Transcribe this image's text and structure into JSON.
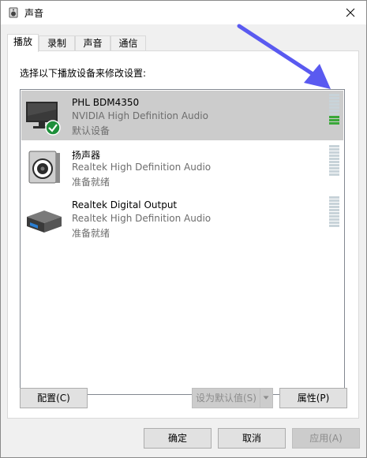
{
  "window": {
    "title": "声音"
  },
  "tabs": [
    {
      "label": "播放",
      "active": true
    },
    {
      "label": "录制",
      "active": false
    },
    {
      "label": "声音",
      "active": false
    },
    {
      "label": "通信",
      "active": false
    }
  ],
  "panel": {
    "instruction": "选择以下播放设备来修改设置:"
  },
  "devices": [
    {
      "name": "PHL BDM4350",
      "driver": "NVIDIA High Definition Audio",
      "status": "默认设备",
      "icon": "monitor-default-icon",
      "selected": true,
      "level": 0.3
    },
    {
      "name": "扬声器",
      "driver": "Realtek High Definition Audio",
      "status": "准备就绪",
      "icon": "speaker-icon",
      "selected": false,
      "level": 0
    },
    {
      "name": "Realtek Digital Output",
      "driver": "Realtek High Definition Audio",
      "status": "准备就绪",
      "icon": "digital-output-icon",
      "selected": false,
      "level": 0
    }
  ],
  "panel_buttons": {
    "configure": "配置(C)",
    "set_default": "设为默认值(S)",
    "properties": "属性(P)"
  },
  "dialog_buttons": {
    "ok": "确定",
    "cancel": "取消",
    "apply": "应用(A)"
  },
  "colors": {
    "selection": "#cccccc",
    "meter_on": "#3aa83a",
    "meter_off": "#c8d3d9",
    "annotation_arrow": "#5a5af0"
  }
}
